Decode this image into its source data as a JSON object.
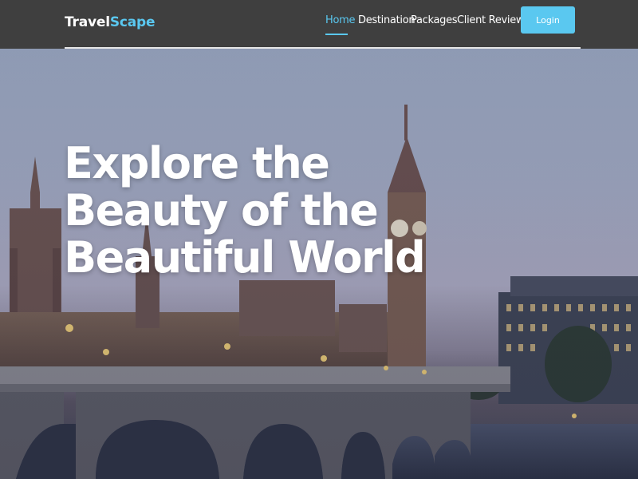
{
  "brand": {
    "part1": "Travel",
    "part2": "Scape"
  },
  "nav": {
    "items": [
      {
        "label": "Home"
      },
      {
        "label": "Destination"
      },
      {
        "label": "Packages"
      },
      {
        "label": "Client Reviews"
      }
    ],
    "login_label": "Login"
  },
  "hero": {
    "headline": "Explore the Beauty of the Beautiful World"
  },
  "colors": {
    "accent": "#5ac8f0",
    "navbar_bg": "#3f3f3f"
  }
}
